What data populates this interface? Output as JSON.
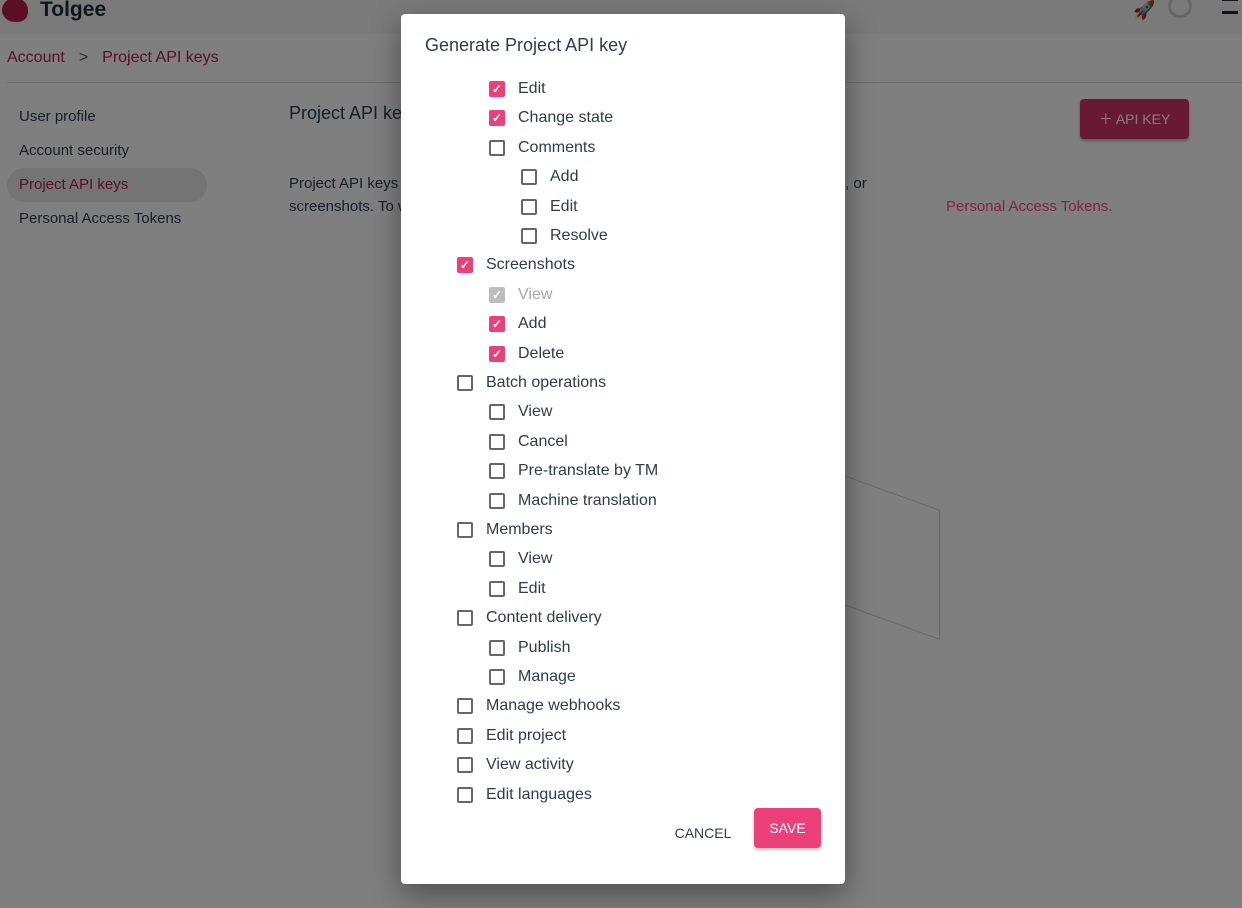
{
  "header": {
    "brand": "Tolgee"
  },
  "breadcrumb": [
    "Account",
    "Project API keys"
  ],
  "sidebar": {
    "items": [
      {
        "label": "User profile"
      },
      {
        "label": "Account security"
      },
      {
        "label": "Project API keys",
        "active": true
      },
      {
        "label": "Personal Access Tokens"
      }
    ]
  },
  "main": {
    "title": "Project API keys",
    "add_button": "API KEY",
    "description_start": "Project API keys are used to work with data in a single project like keys, translations, or screenshots. To work with multiple projects or organizations use ",
    "description_link": "Personal Access Tokens",
    "description_end": "."
  },
  "dialog": {
    "title": "Generate Project API key",
    "cancel": "CANCEL",
    "save": "SAVE",
    "permissions": [
      {
        "label": "Edit",
        "level": 1,
        "checked": true
      },
      {
        "label": "Change state",
        "level": 1,
        "checked": true
      },
      {
        "label": "Comments",
        "level": 1,
        "checked": false
      },
      {
        "label": "Add",
        "level": 2,
        "checked": false
      },
      {
        "label": "Edit",
        "level": 2,
        "checked": false
      },
      {
        "label": "Resolve",
        "level": 2,
        "checked": false
      },
      {
        "label": "Screenshots",
        "level": 0,
        "checked": true
      },
      {
        "label": "View",
        "level": 1,
        "checked": true,
        "disabled": true
      },
      {
        "label": "Add",
        "level": 1,
        "checked": true
      },
      {
        "label": "Delete",
        "level": 1,
        "checked": true
      },
      {
        "label": "Batch operations",
        "level": 0,
        "checked": false
      },
      {
        "label": "View",
        "level": 1,
        "checked": false
      },
      {
        "label": "Cancel",
        "level": 1,
        "checked": false
      },
      {
        "label": "Pre-translate by TM",
        "level": 1,
        "checked": false
      },
      {
        "label": "Machine translation",
        "level": 1,
        "checked": false
      },
      {
        "label": "Members",
        "level": 0,
        "checked": false
      },
      {
        "label": "View",
        "level": 1,
        "checked": false
      },
      {
        "label": "Edit",
        "level": 1,
        "checked": false
      },
      {
        "label": "Content delivery",
        "level": 0,
        "checked": false
      },
      {
        "label": "Publish",
        "level": 1,
        "checked": false
      },
      {
        "label": "Manage",
        "level": 1,
        "checked": false
      },
      {
        "label": "Manage webhooks",
        "level": 0,
        "checked": false
      },
      {
        "label": "Edit project",
        "level": 0,
        "checked": false
      },
      {
        "label": "View activity",
        "level": 0,
        "checked": false
      },
      {
        "label": "Edit languages",
        "level": 0,
        "checked": false
      }
    ]
  },
  "colors": {
    "accent": "#ec407a",
    "brand": "#b3204f"
  }
}
